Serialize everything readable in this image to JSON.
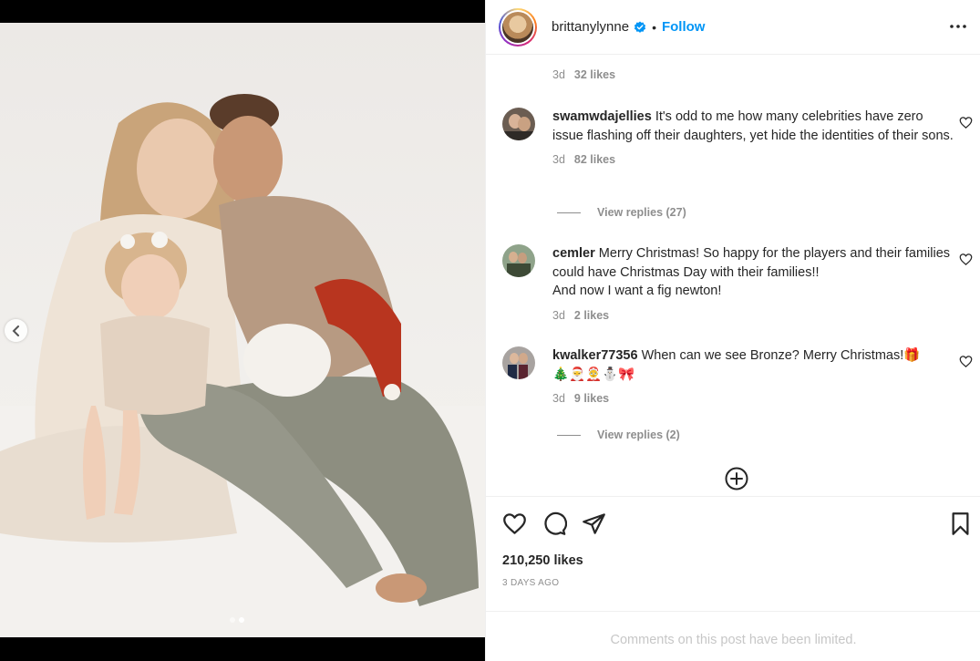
{
  "post": {
    "username": "brittanylynne",
    "follow_label": "Follow",
    "separator": "•",
    "likes": "210,250 likes",
    "time_ago": "3 DAYS AGO",
    "comments_limited": "Comments on this post have been limited."
  },
  "carousel": {
    "total_slides": 2,
    "active_slide": 2
  },
  "partial_comment": {
    "time": "3d",
    "likes": "32 likes"
  },
  "comments": [
    {
      "username": "swamwdajellies",
      "text": "It's odd to me how many celebrities have zero issue flashing off their daughters, yet hide the identities of their sons.",
      "time": "3d",
      "likes": "82 likes",
      "view_replies": "View replies (27)"
    },
    {
      "username": "cemler",
      "text": "Merry Christmas! So happy for the players and their families could have Christmas Day with their families!!",
      "text_line2": "And now I want a fig newton!",
      "time": "3d",
      "likes": "2 likes"
    },
    {
      "username": "kwalker77356",
      "text": "When can we see Bronze? Merry Christmas!🎁",
      "text_line2": "🎄🎅🤶⛄🎀",
      "time": "3d",
      "likes": "9 likes",
      "view_replies": "View replies (2)"
    }
  ],
  "colors": {
    "accent": "#0095f6",
    "verified": "#0095f6",
    "muted": "#8e8e8e",
    "text": "#262626"
  },
  "icons": {
    "header": [
      "verified-badge-icon",
      "more-options-icon"
    ],
    "actions": [
      "heart-icon",
      "comment-icon",
      "share-icon",
      "bookmark-icon"
    ],
    "carousel": [
      "chevron-left-icon"
    ],
    "comments": [
      "load-more-plus-icon"
    ]
  }
}
